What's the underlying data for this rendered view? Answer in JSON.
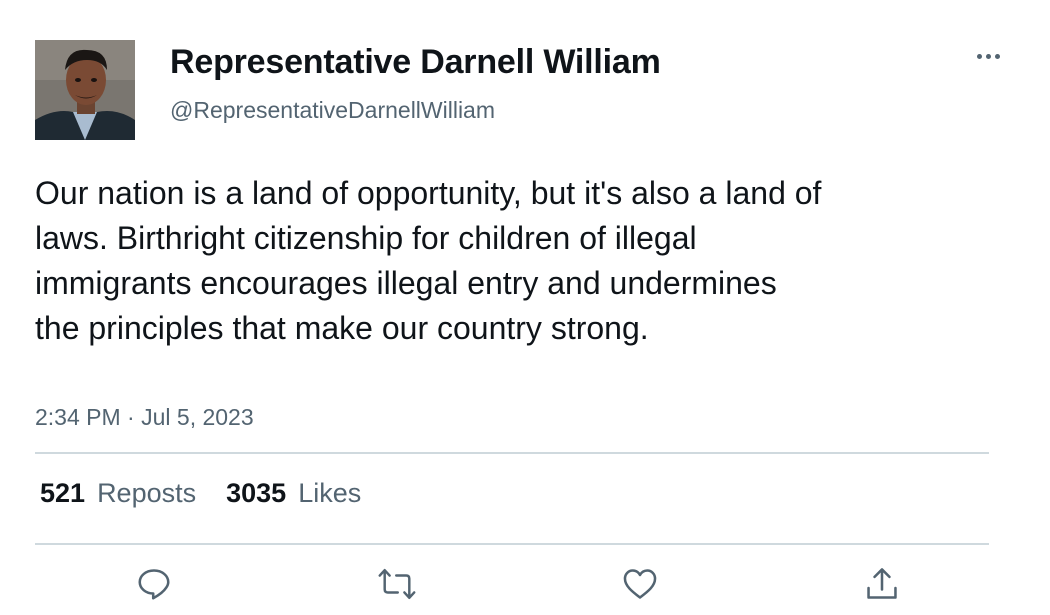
{
  "author": {
    "display_name": "Representative Darnell William",
    "handle": "@RepresentativeDarnellWilliam",
    "avatar_icon": "profile-photo"
  },
  "tweet": {
    "text": "Our nation is a land of opportunity, but it's also a land of laws. Birthright citizenship for children of illegal immigrants encourages illegal entry and undermines the principles that make our country strong.",
    "time": "2:34 PM",
    "separator": "·",
    "date": "Jul 5, 2023"
  },
  "stats": {
    "reposts_count": "521",
    "reposts_label": "Reposts",
    "likes_count": "3035",
    "likes_label": "Likes"
  },
  "actions": [
    {
      "name": "reply",
      "icon": "speech-bubble-icon"
    },
    {
      "name": "repost",
      "icon": "repost-arrows-icon"
    },
    {
      "name": "like",
      "icon": "heart-icon"
    },
    {
      "name": "share",
      "icon": "share-arrow-icon"
    }
  ],
  "colors": {
    "text_primary": "#0f1419",
    "text_secondary": "#536471",
    "divider": "#cfd9de"
  }
}
